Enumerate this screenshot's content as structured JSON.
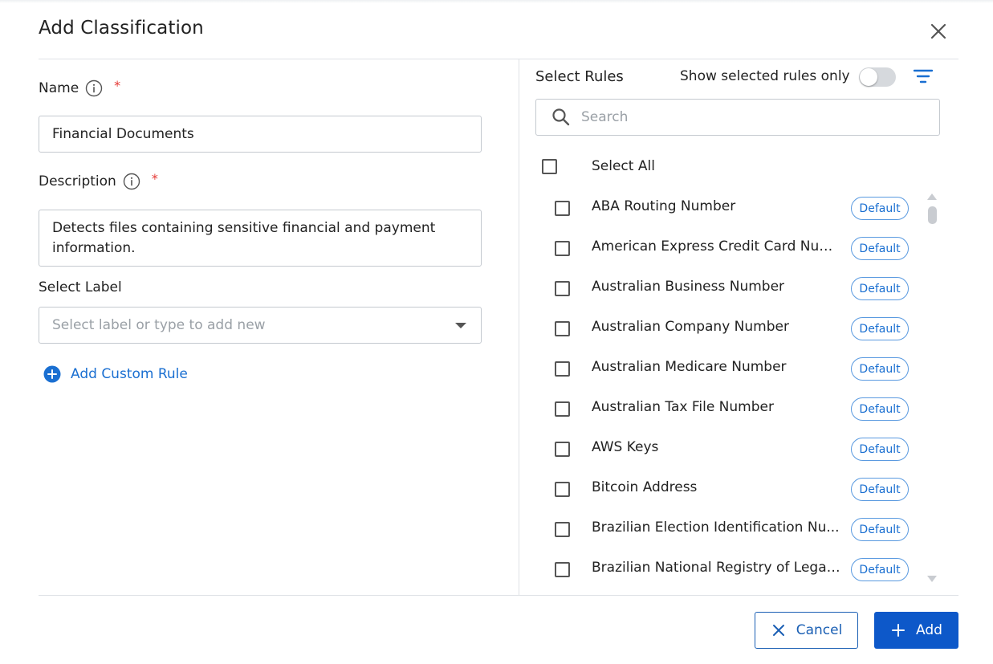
{
  "dialog": {
    "title": "Add Classification"
  },
  "form": {
    "name_label": "Name",
    "name_required": "*",
    "name_value": "Financial Documents",
    "description_label": "Description",
    "description_required": "*",
    "description_value": "Detects files containing sensitive financial and payment information.",
    "select_label_label": "Select Label",
    "select_label_placeholder": "Select label or type to add new",
    "add_custom_rule": "Add Custom Rule"
  },
  "rules": {
    "title": "Select Rules",
    "toggle_label": "Show selected rules only",
    "toggle_on": false,
    "search_placeholder": "Search",
    "select_all": "Select All",
    "items": [
      {
        "label": "ABA Routing Number",
        "badge": "Default"
      },
      {
        "label": "American Express Credit Card Num...",
        "badge": "Default"
      },
      {
        "label": "Australian Business Number",
        "badge": "Default"
      },
      {
        "label": "Australian Company Number",
        "badge": "Default"
      },
      {
        "label": "Australian Medicare Number",
        "badge": "Default"
      },
      {
        "label": "Australian Tax File Number",
        "badge": "Default"
      },
      {
        "label": "AWS Keys",
        "badge": "Default"
      },
      {
        "label": "Bitcoin Address",
        "badge": "Default"
      },
      {
        "label": "Brazilian Election Identification Nu...",
        "badge": "Default"
      },
      {
        "label": "Brazilian National Registry of Legal E...",
        "badge": "Default"
      }
    ]
  },
  "footer": {
    "cancel_label": "Cancel",
    "add_label": "Add"
  },
  "colors": {
    "accent": "#1a6fd1",
    "primary_button": "#0d58c9",
    "required": "#e53935"
  },
  "icons": {
    "close": "close-icon",
    "info": "info-icon",
    "plus_circle": "plus-circle-icon",
    "filter": "filter-icon",
    "search": "search-icon",
    "dropdown": "caret-down-icon"
  }
}
